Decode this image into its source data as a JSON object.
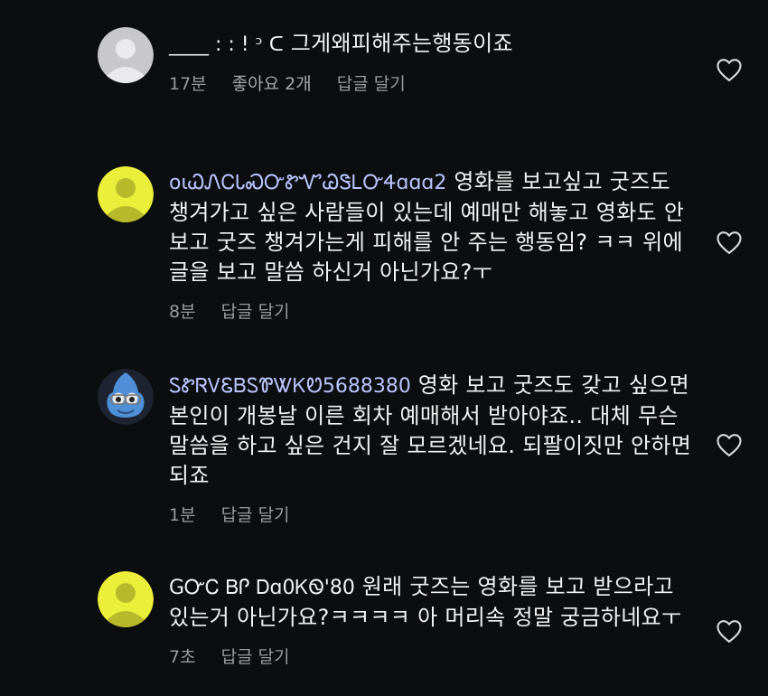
{
  "comments": [
    {
      "username": "____ : : ! ᵓ ᑕ",
      "username_color": "#f2f2f2",
      "text": "그게왜피해주는행동이죠",
      "time": "17분",
      "likes": "좋아요 2개",
      "reply": "답글 달기",
      "avatar": "default-avatar-gray"
    },
    {
      "username": "oɩᏇᏁᏟᏓᏍᏅᏑᏉᏊᏕᏞᏅᏎɑɑɑ2",
      "username_color": "#b9c4ff",
      "text": "영화를 보고싶고 굿즈도 챙겨가고 싶은 사람들이 있는데 예매만 해놓고 영화도 안 보고 굿즈 챙겨가는게 피해를 안 주는 행동임? ㅋㅋ 위에 글을 보고 말씀 하신거 아닌가요?ㅜ",
      "time": "8분",
      "reply": "답글 달기",
      "avatar": "default-avatar-yellow"
    },
    {
      "username": "ᏚᏑᏒᏙᏋᏴᏚᏈᏔᏦᏬ5688380",
      "username_color": "#b9c4ff",
      "text": "영화 보고 굿즈도 갖고 싶으면 본인이 개봉날 이른 회차 예매해서 받아야죠.. 대체 무슨 말씀을 하고 싶은 건지 잘 모르겠네요. 되팔이짓만 안하면 되죠",
      "time": "1분",
      "reply": "답글 달기",
      "avatar": "character-avatar"
    },
    {
      "username": "GᏅᏟ ᏴᎵ Ꭰɑ0ᏦᏫ'80",
      "username_color": "#f2f2f2",
      "text": "원래 굿즈는 영화를 보고 받으라고 있는거 아닌가요?ㅋㅋㅋㅋ 아 머리속 정말 궁금하네요ㅜ",
      "time": "7초",
      "reply": "답글 달기",
      "avatar": "default-avatar-yellow"
    }
  ],
  "icons": {
    "like": "heart-outline-icon"
  },
  "colors": {
    "background": "#0b0d0f",
    "meta": "#9a9a9a",
    "avatar_yellow": "#ecef3a",
    "avatar_gray": "#c7c7cc"
  }
}
